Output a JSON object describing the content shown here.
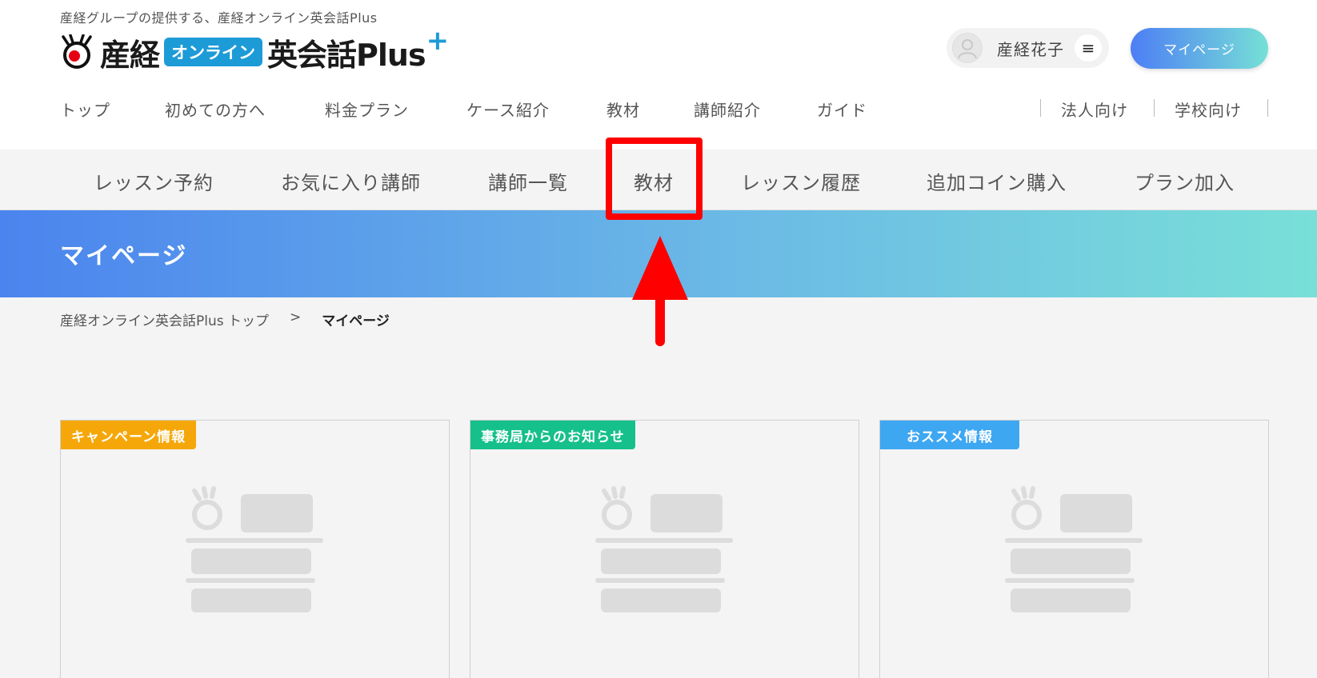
{
  "header": {
    "tagline": "産経グループの提供する、産経オンライン英会話Plus",
    "logo": {
      "sankei": "産経",
      "online": "オンライン",
      "eikaiwa": "英会話Plus",
      "plus": "+"
    },
    "user_name": "産経花子",
    "menu_icon": "≡",
    "mypage_label": "マイページ"
  },
  "main_nav": {
    "items": [
      "トップ",
      "初めての方へ",
      "料金プラン",
      "ケース紹介",
      "教材",
      "講師紹介",
      "ガイド"
    ],
    "right_items": [
      "法人向け",
      "学校向け"
    ]
  },
  "sub_nav": {
    "items": [
      "レッスン予約",
      "お気に入り講師",
      "講師一覧",
      "教材",
      "レッスン履歴",
      "追加コイン購入",
      "プラン加入"
    ]
  },
  "banner": {
    "title": "マイページ"
  },
  "breadcrumb": {
    "home": "産経オンライン英会話Plus トップ",
    "separator": ">",
    "current": "マイページ"
  },
  "cards": [
    {
      "badge": "キャンペーン情報",
      "color": "#f5a70a"
    },
    {
      "badge": "事務局からのお知らせ",
      "color": "#16c08a"
    },
    {
      "badge": "おススメ情報",
      "color": "#3ea7f2"
    }
  ],
  "colors": {
    "accent_blue": "#4b84ee",
    "accent_teal": "#79dfd8",
    "annotation_red": "#ff0000"
  }
}
